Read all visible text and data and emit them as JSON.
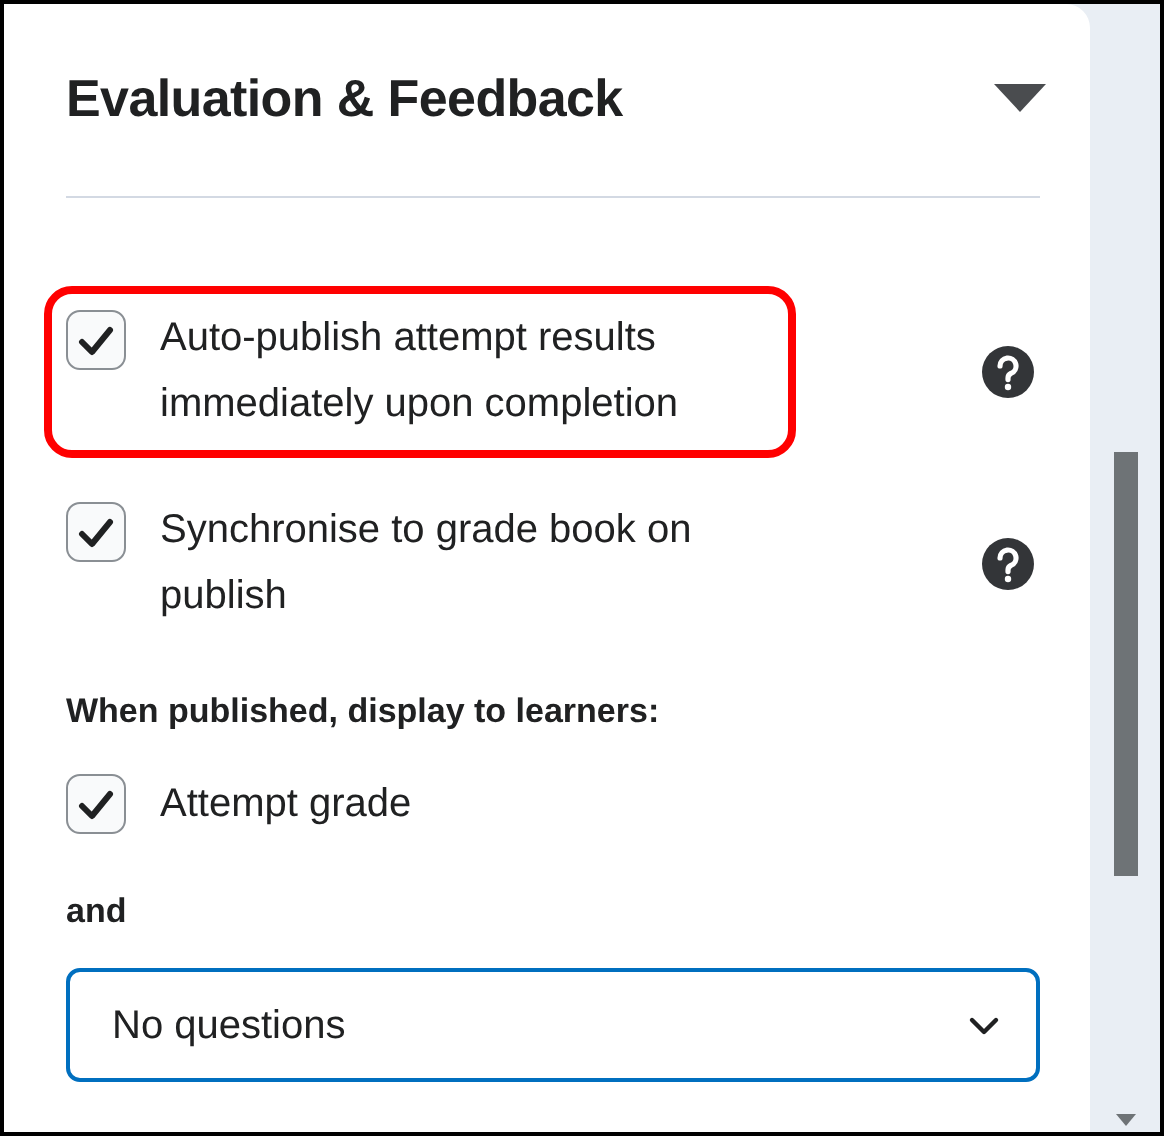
{
  "section": {
    "title": "Evaluation & Feedback",
    "expanded": true
  },
  "options": [
    {
      "label": "Auto-publish attempt results immediately upon completion",
      "checked": true,
      "highlighted": true,
      "help": true
    },
    {
      "label": "Synchronise to grade book on publish",
      "checked": true,
      "highlighted": false,
      "help": true
    }
  ],
  "display_heading": "When published, display to learners:",
  "display_options": [
    {
      "label": "Attempt grade",
      "checked": true
    }
  ],
  "and_label": "and",
  "select": {
    "value": "No questions",
    "focused": true
  }
}
